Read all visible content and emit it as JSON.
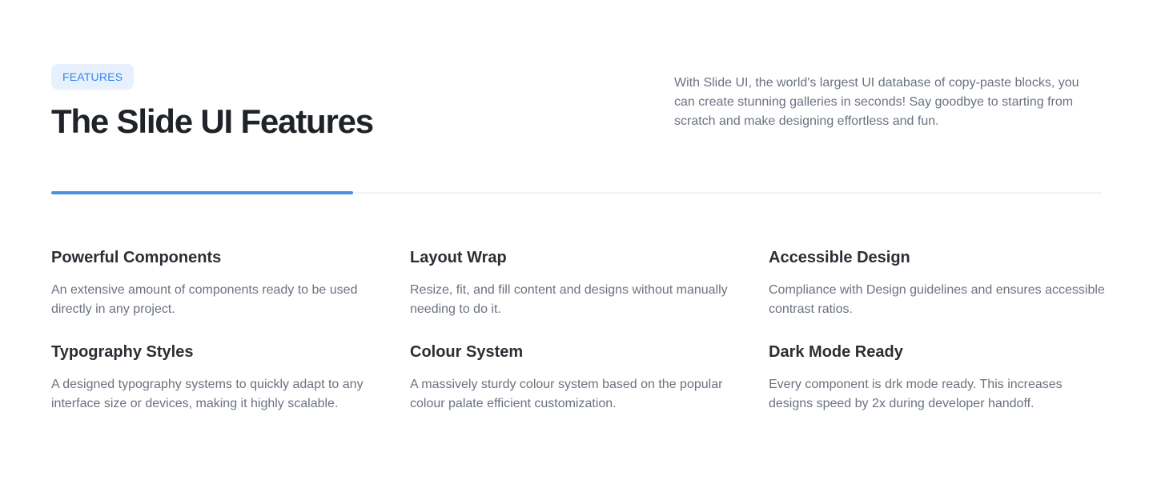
{
  "header": {
    "badge": "FEATURES",
    "title": "The Slide UI Features",
    "intro": "With Slide UI, the world's largest UI database of copy-paste blocks, you can create stunning galleries in seconds! Say goodbye to starting from scratch and make designing effortless and fun."
  },
  "progress": {
    "fill_fraction": 0.287,
    "color": "#4a8fe8"
  },
  "features": [
    {
      "title": "Powerful Components",
      "description": "An extensive amount of components ready to be used directly in any project."
    },
    {
      "title": "Layout Wrap",
      "description": "Resize, fit, and fill content and designs without manually needing to do it."
    },
    {
      "title": "Accessible Design",
      "description": "Compliance with Design guidelines and ensures accessible contrast ratios."
    },
    {
      "title": "Typography Styles",
      "description": "A designed typography systems to quickly adapt to any interface size or devices, making it highly scalable."
    },
    {
      "title": "Colour System",
      "description": "A massively sturdy colour system based on the popular colour palate efficient customization."
    },
    {
      "title": "Dark Mode Ready",
      "description": "Every component is drk mode ready. This increases designs speed by 2x during developer handoff."
    }
  ]
}
